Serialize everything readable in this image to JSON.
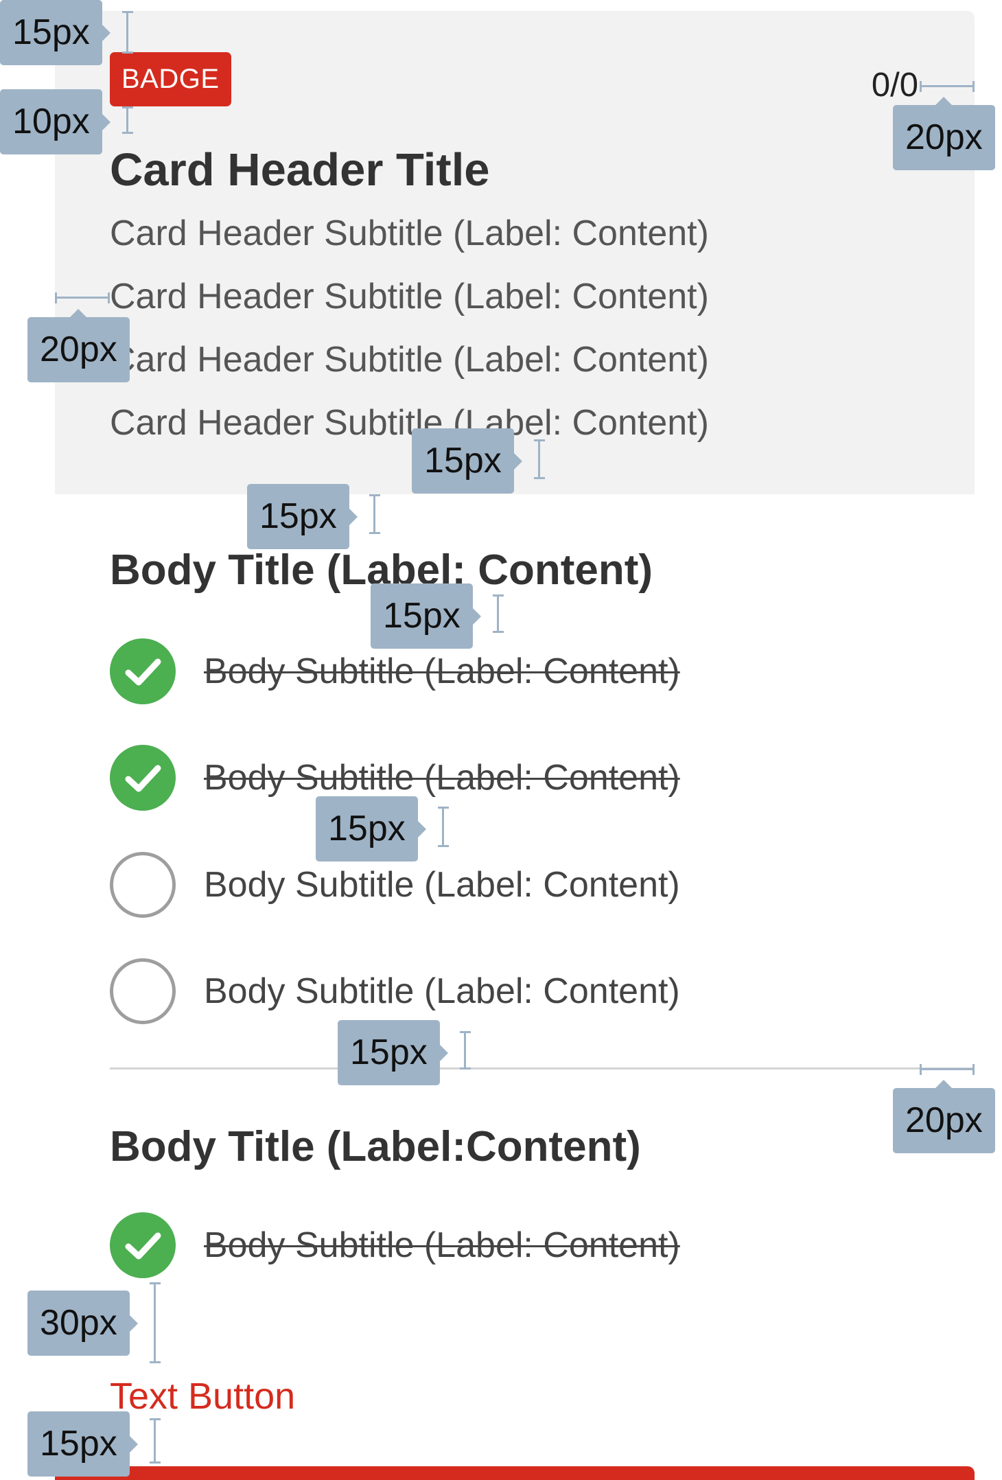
{
  "card_header": {
    "badge": "BADGE",
    "counter": "0/0",
    "title": "Card Header Title",
    "subtitles": [
      "Card Header Subtitle (Label: Content)",
      "Card Header Subtitle (Label: Content)",
      "Card Header Subtitle (Label: Content)",
      "Card Header Subtitle (Label: Content)"
    ]
  },
  "sections": [
    {
      "title": "Body Title (Label: Content)",
      "items": [
        {
          "label": "Body Subtitle (Label: Content)",
          "completed": true
        },
        {
          "label": "Body Subtitle (Label: Content)",
          "completed": true
        },
        {
          "label": "Body Subtitle (Label: Content)",
          "completed": false
        },
        {
          "label": "Body Subtitle (Label: Content)",
          "completed": false
        }
      ]
    },
    {
      "title": "Body Title (Label:Content)",
      "items": [
        {
          "label": "Body Subtitle (Label: Content)",
          "completed": true
        }
      ]
    }
  ],
  "text_button": "Text Button",
  "spacing_annotations": [
    "15px",
    "10px",
    "20px",
    "20px",
    "15px",
    "15px",
    "15px",
    "15px",
    "15px",
    "20px",
    "30px",
    "15px"
  ],
  "colors": {
    "accent_red": "#d52b1e",
    "check_green": "#4caf50",
    "unchecked_gray": "#9e9e9e",
    "header_background": "#f2f2f2",
    "annotation_blue_gray": "#9fb3c6"
  }
}
